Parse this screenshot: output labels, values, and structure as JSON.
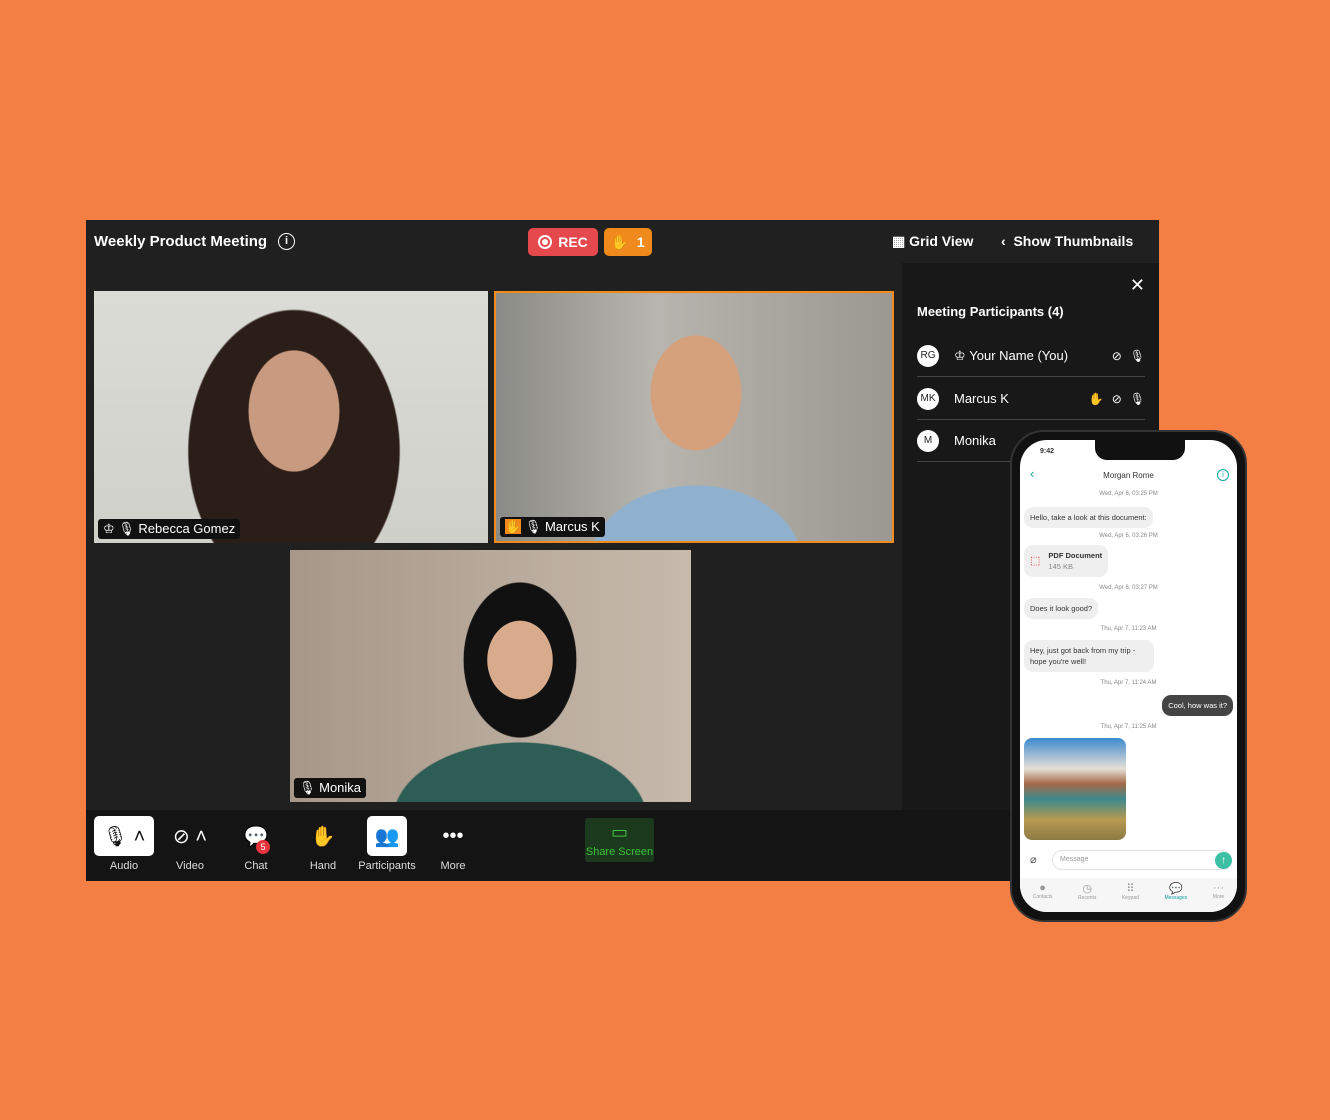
{
  "meeting": {
    "title": "Weekly Product Meeting",
    "rec_label": "REC",
    "raised_hands": "1",
    "grid_view": "Grid View",
    "show_thumbnails": "Show Thumbnails"
  },
  "tiles": [
    {
      "name": "Rebecca Gomez"
    },
    {
      "name": "Marcus K"
    },
    {
      "name": "Monika"
    }
  ],
  "panel": {
    "title": "Meeting Participants (4)",
    "participants": [
      {
        "initials": "RG",
        "name": "Your Name (You)"
      },
      {
        "initials": "MK",
        "name": "Marcus K"
      },
      {
        "initials": "M",
        "name": "Monika"
      }
    ]
  },
  "toolbar": {
    "audio": "Audio",
    "video": "Video",
    "chat": "Chat",
    "chat_badge": "5",
    "hand": "Hand",
    "participants": "Participants",
    "more": "More",
    "share": "Share Screen"
  },
  "colors": {
    "background": "#f47f45",
    "rec": "#e5484d",
    "hand": "#f08a1c",
    "share": "#3ec13b",
    "accent": "#13a3a3"
  },
  "phone": {
    "time": "9:42",
    "contact": "Morgan Rome",
    "messages": [
      {
        "ts": "Wed, Apr 6, 03:25 PM",
        "text": "Hello, take a look at this document:"
      },
      {
        "ts": "Wed, Apr 6, 03:26 PM",
        "file": "PDF Document",
        "size": "145 KB"
      },
      {
        "ts": "Wed, Apr 6, 03:27 PM",
        "text": "Does it look good?"
      },
      {
        "ts": "Thu, Apr 7, 11:23 AM",
        "text": "Hey, just got back from my trip - hope you're well!"
      },
      {
        "ts": "Thu, Apr 7, 11:24 AM",
        "text": "Cool, how was it?"
      },
      {
        "ts": "Thu, Apr 7, 11:25 AM"
      }
    ],
    "placeholder": "Message",
    "tabs": [
      "Contacts",
      "Recents",
      "Keypad",
      "Messages",
      "More"
    ]
  }
}
